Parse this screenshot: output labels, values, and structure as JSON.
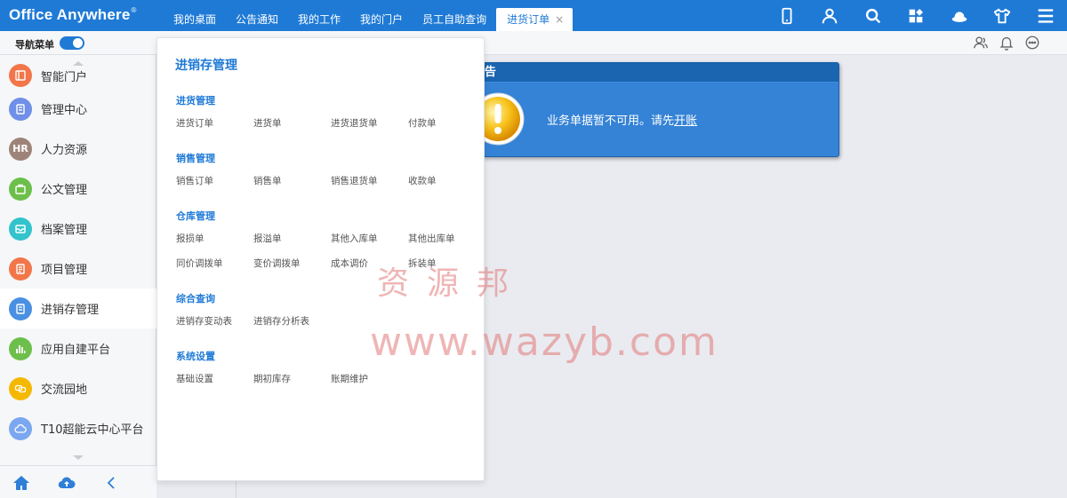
{
  "app": {
    "logo_text": "Office Anywhere",
    "logo_mark": "®"
  },
  "tabs": [
    {
      "label": "我的桌面"
    },
    {
      "label": "公告通知"
    },
    {
      "label": "我的工作"
    },
    {
      "label": "我的门户"
    },
    {
      "label": "员工自助查询"
    },
    {
      "label": "进货订单",
      "close": "×"
    }
  ],
  "top_icons": [
    "mobile-icon",
    "user-icon",
    "search-icon",
    "apps-icon",
    "cloud-hat-icon",
    "shirt-icon",
    "menu-icon"
  ],
  "subbar": {
    "nav_menu_label": "导航菜单",
    "icons": [
      "contacts-icon",
      "bell-icon",
      "chat-icon"
    ]
  },
  "sidebar": {
    "items": [
      {
        "label": "智能门户",
        "color": "#f2764a",
        "icon": "portal-icon"
      },
      {
        "label": "管理中心",
        "color": "#6f8fe8",
        "icon": "document-icon"
      },
      {
        "label": "人力资源",
        "color": "#9e8478",
        "icon_text": "HR"
      },
      {
        "label": "公文管理",
        "color": "#6dbf4b",
        "icon": "briefcase-icon"
      },
      {
        "label": "档案管理",
        "color": "#33c3cc",
        "icon": "archive-icon"
      },
      {
        "label": "项目管理",
        "color": "#f2764a",
        "icon": "project-icon"
      },
      {
        "label": "进销存管理",
        "color": "#4a90e2",
        "icon": "inventory-icon"
      },
      {
        "label": "应用自建平台",
        "color": "#6dbf4b",
        "icon": "chart-icon"
      },
      {
        "label": "交流园地",
        "color": "#f5b800",
        "icon": "chat-bubble-icon"
      },
      {
        "label": "T10超能云中心平台",
        "color": "#7aa7f0",
        "icon": "cloud-icon"
      }
    ],
    "active_index": 6,
    "footer_icons": [
      "home-icon",
      "cloud-upload-icon",
      "collapse-icon"
    ]
  },
  "panel": {
    "title": "进销存管理",
    "sections": [
      {
        "title": "进货管理",
        "items": [
          "进货订单",
          "进货单",
          "进货退货单",
          "付款单"
        ]
      },
      {
        "title": "销售管理",
        "items": [
          "销售订单",
          "销售单",
          "销售退货单",
          "收款单"
        ]
      },
      {
        "title": "仓库管理",
        "items": [
          "报损单",
          "报溢单",
          "其他入库单",
          "其他出库单",
          "同价调拨单",
          "变价调拨单",
          "成本调价",
          "拆装单"
        ]
      },
      {
        "title": "综合查询",
        "items": [
          "进销存变动表",
          "进销存分析表"
        ]
      },
      {
        "title": "系统设置",
        "items": [
          "基础设置",
          "期初库存",
          "账期维护"
        ]
      }
    ]
  },
  "alert": {
    "title": "告",
    "message_prefix": "业务单据暂不可用。请先",
    "message_link": "开账"
  },
  "watermark": {
    "cn": "资源邦",
    "en": "www.wazyb.com"
  }
}
